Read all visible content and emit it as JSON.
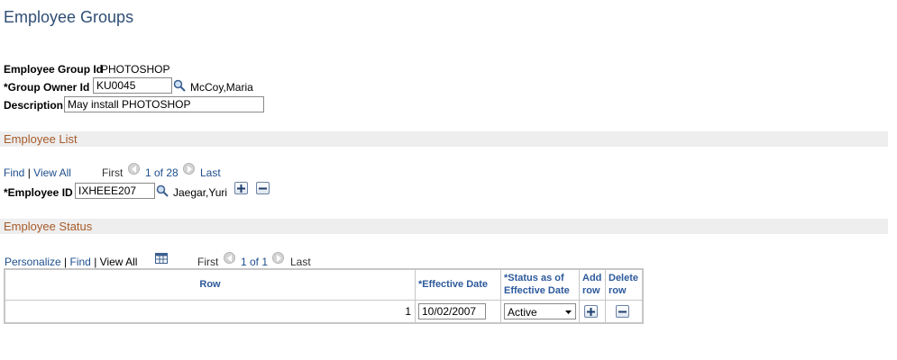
{
  "page": {
    "title": "Employee Groups"
  },
  "header_fields": {
    "group_id_label": "Employee Group Id",
    "group_id_value": "PHOTOSHOP",
    "owner_label": "*Group Owner Id",
    "owner_value": "KU0045",
    "owner_name": "McCoy,Maria",
    "description_label": "Description",
    "description_value": "May install PHOTOSHOP"
  },
  "employee_list": {
    "section_title": "Employee List",
    "find": "Find",
    "sep": "|",
    "view_all": "View All",
    "first": "First",
    "counter": "1 of 28",
    "last": "Last",
    "employee_id_label": "*Employee ID",
    "employee_id_value": "IXHEEE207",
    "employee_name": "Jaegar,Yuri"
  },
  "employee_status": {
    "section_title": "Employee Status",
    "personalize": "Personalize",
    "sep": "|",
    "find": "Find",
    "view_all": "View All",
    "first": "First",
    "counter": "1 of 1",
    "last": "Last",
    "columns": {
      "row": "Row",
      "effective_date": "*Effective Date",
      "status": "*Status as of Effective Date",
      "add_row": "Add row",
      "delete_row": "Delete row"
    },
    "rows": [
      {
        "row": "1",
        "effective_date": "10/02/2007",
        "status": "Active"
      }
    ]
  },
  "icons": {
    "lookup": "magnifier-icon",
    "add": "plus-icon",
    "delete": "minus-icon",
    "prev": "arrow-left-icon",
    "next": "arrow-right-icon",
    "download": "spreadsheet-icon"
  },
  "colors": {
    "title": "#2f4e75",
    "section_text": "#a65b2a",
    "section_bg": "#eeeeee",
    "link": "#1e4f8c",
    "grid_header": "#2d5a9b"
  }
}
